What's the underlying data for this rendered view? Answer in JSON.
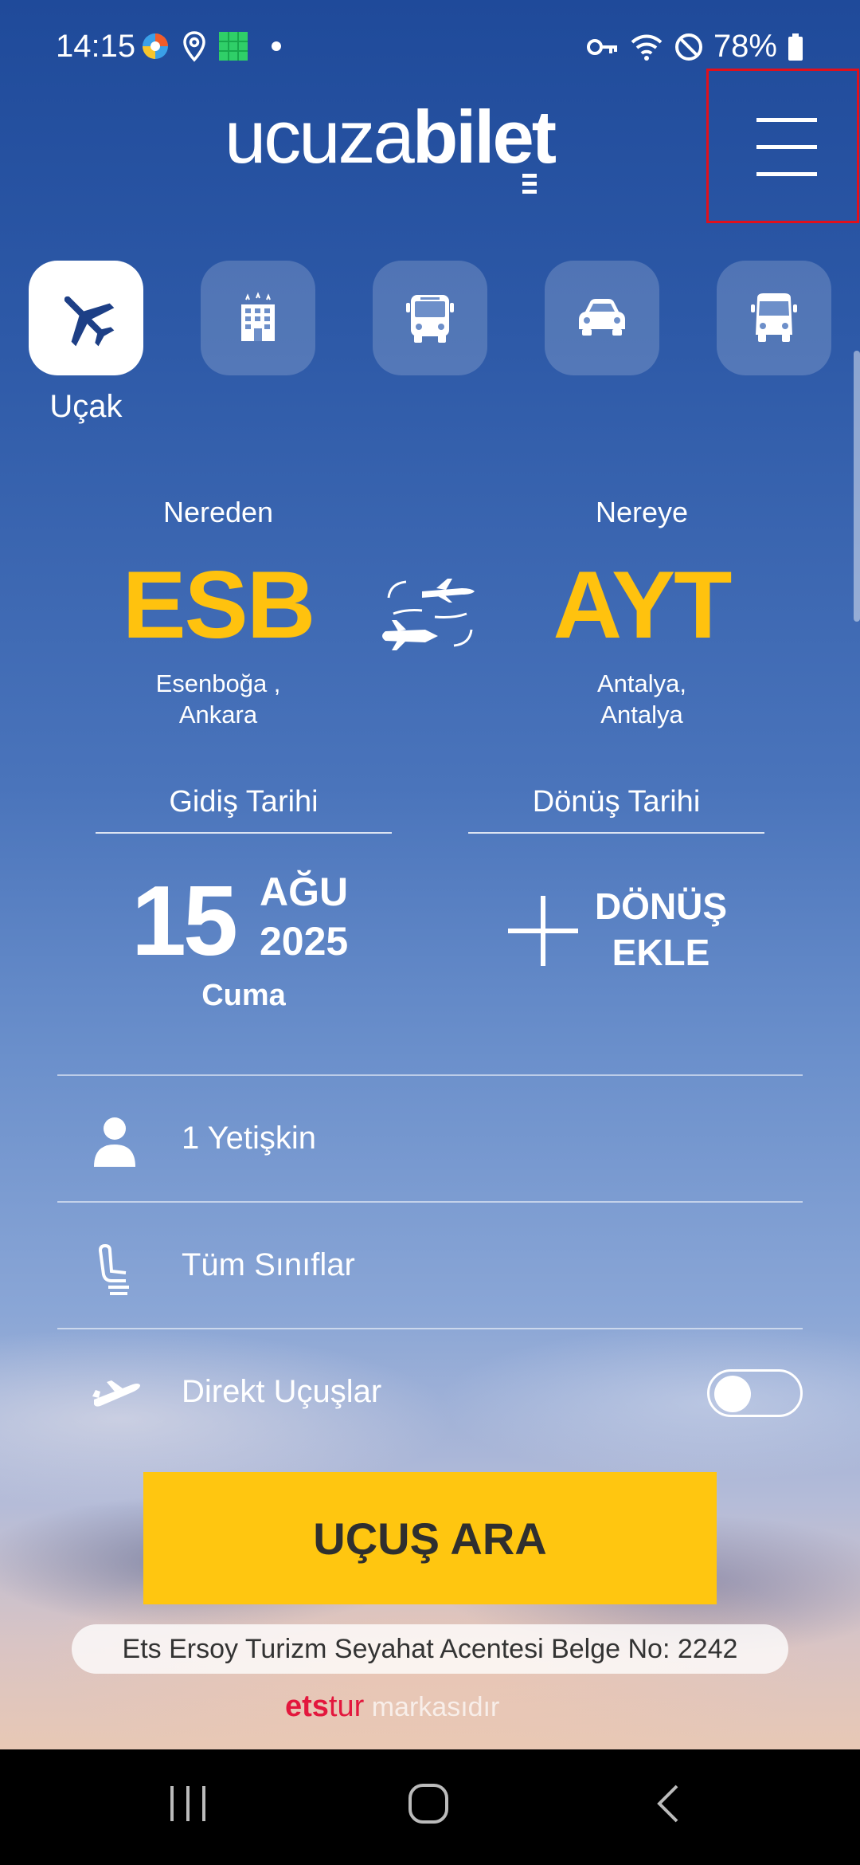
{
  "status_bar": {
    "time": "14:15",
    "battery": "78%",
    "icons": [
      "colorful-app-icon",
      "location-icon",
      "green-app-icon",
      "notification-dot",
      "key-icon",
      "wifi-icon",
      "do-not-disturb-icon",
      "battery-icon"
    ]
  },
  "header": {
    "logo_part1": "ucuza",
    "logo_part2": "bilet",
    "menu_icon": "hamburger-menu-icon"
  },
  "categories": [
    {
      "icon": "airplane-icon",
      "label": "Uçak",
      "active": true
    },
    {
      "icon": "hotel-icon",
      "label": "",
      "active": false
    },
    {
      "icon": "bus-icon",
      "label": "",
      "active": false
    },
    {
      "icon": "car-icon",
      "label": "",
      "active": false
    },
    {
      "icon": "minibus-icon",
      "label": "",
      "active": false
    }
  ],
  "route": {
    "from_label": "Nereden",
    "from_code": "ESB",
    "from_name_line1": "Esenboğa ,",
    "from_name_line2": "Ankara",
    "to_label": "Nereye",
    "to_code": "AYT",
    "to_name_line1": "Antalya,",
    "to_name_line2": "Antalya"
  },
  "dates": {
    "departure_label": "Gidiş Tarihi",
    "day": "15",
    "month": "AĞU",
    "year": "2025",
    "weekday": "Cuma",
    "return_label": "Dönüş Tarihi",
    "return_line1": "DÖNÜŞ",
    "return_line2": "EKLE"
  },
  "options": {
    "passengers": "1 Yetişkin",
    "cabin": "Tüm Sınıflar",
    "direct": "Direkt Uçuşlar",
    "direct_enabled": false
  },
  "search_button": "UÇUŞ ARA",
  "license": "Ets Ersoy Turizm Seyahat Acentesi Belge No: 2242",
  "brand": {
    "part1": "ets",
    "part2": "tur",
    "suffix": " markasıdır"
  },
  "colors": {
    "accent": "#ffc20e",
    "button": "#ffc610",
    "brand_red": "#e3173d"
  }
}
